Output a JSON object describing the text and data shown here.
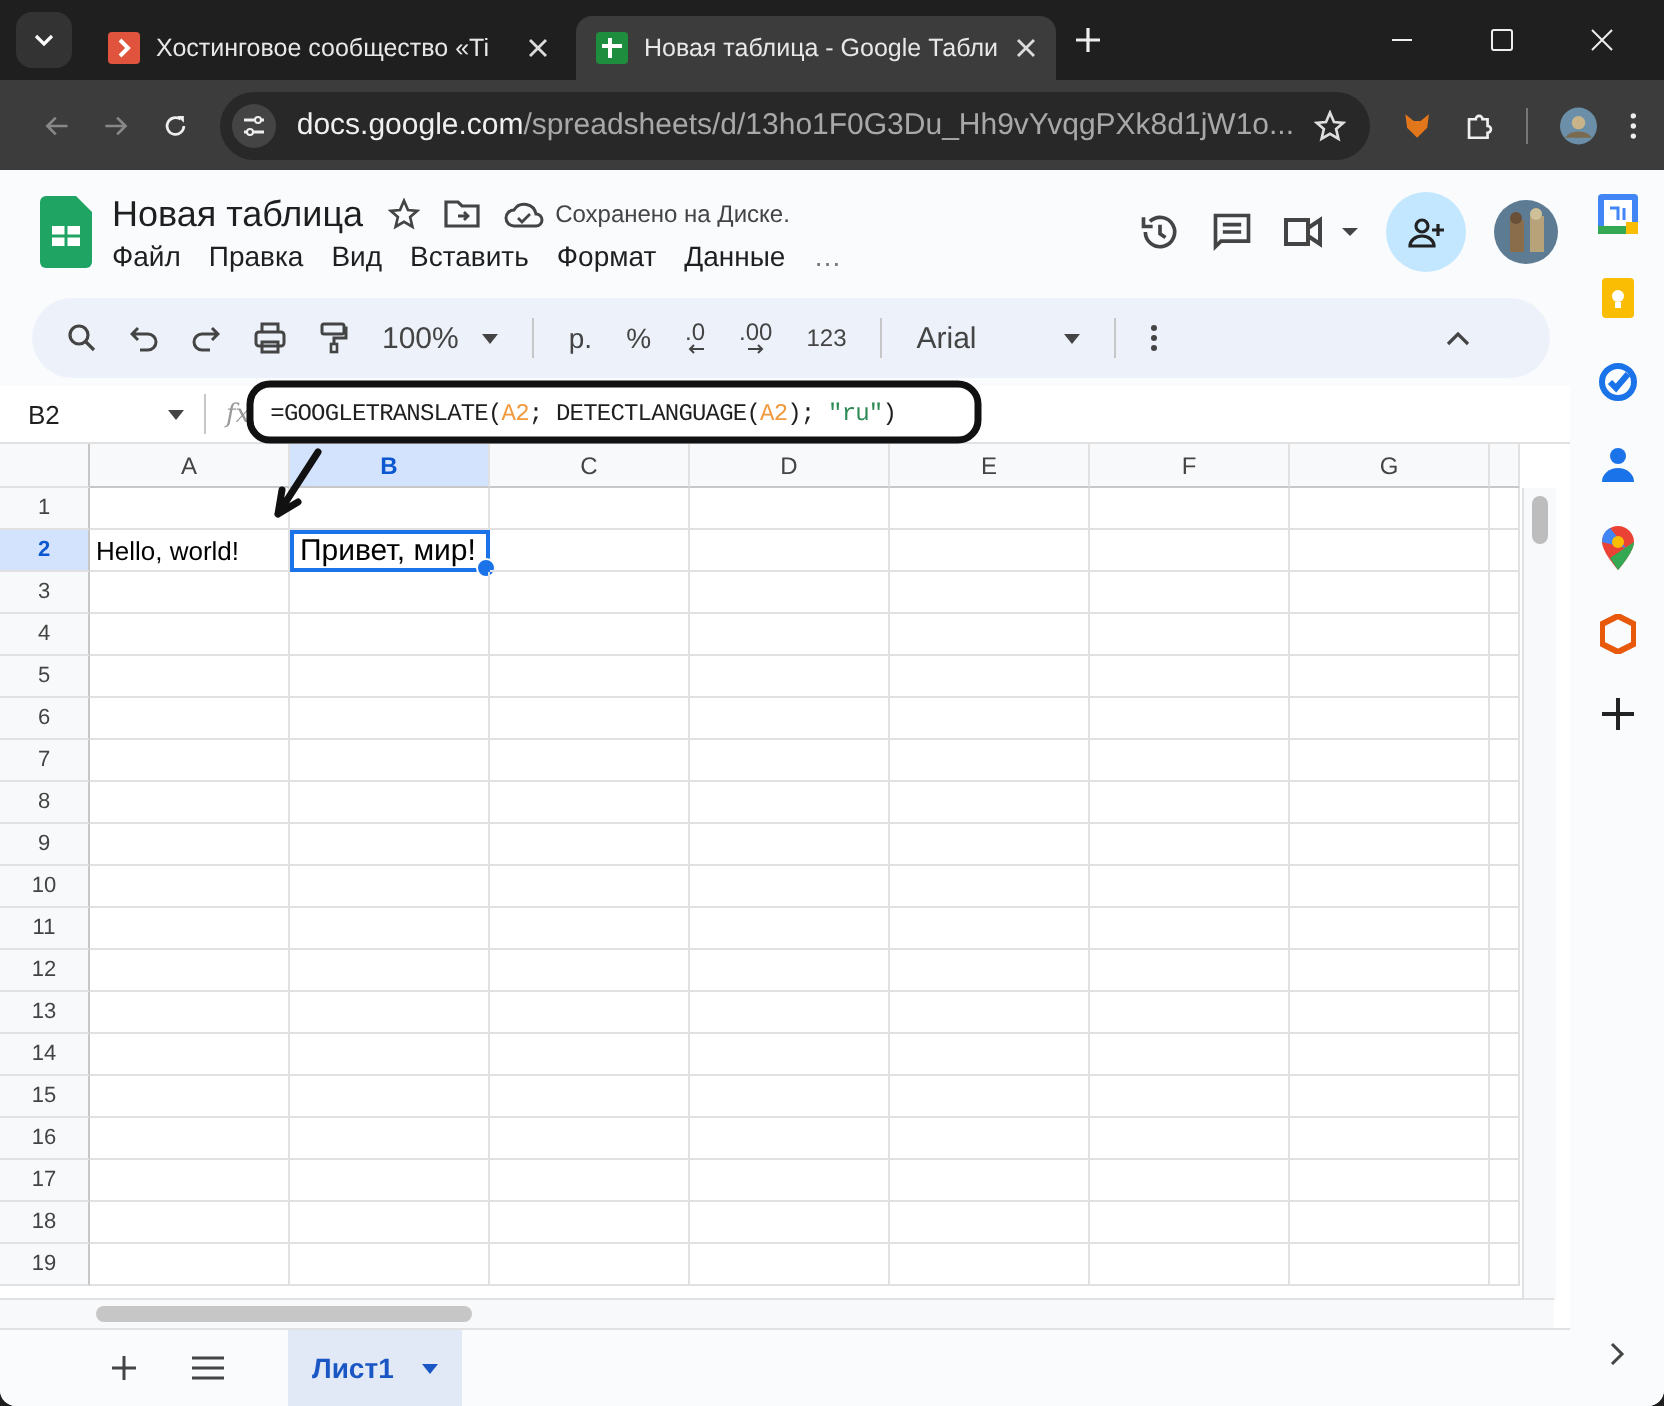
{
  "browser": {
    "tabs": [
      {
        "title": "Хостинговое сообщество «Ti",
        "kind": "site",
        "selected": false
      },
      {
        "title": "Новая таблица - Google Табли",
        "kind": "sheets",
        "selected": true
      }
    ],
    "url": {
      "host": "docs.google.com",
      "path": "/spreadsheets/d/13ho1F0G3Du_Hh9vYvqgPXk8d1jW1o..."
    }
  },
  "doc": {
    "title": "Новая таблица",
    "save_status": "Сохранено на Диске.",
    "menu": [
      "Файл",
      "Правка",
      "Вид",
      "Вставить",
      "Формат",
      "Данные"
    ],
    "menu_more": "…"
  },
  "toolbar": {
    "zoom": "100%",
    "currency": "р.",
    "percent": "%",
    "decrease_decimals": ".0",
    "increase_decimals": ".00",
    "number_format": "123",
    "font": "Arial"
  },
  "name_box": "B2",
  "function_symbol": "fx",
  "formula": [
    {
      "text": "=GOOGLETRANSLATE(",
      "kind": "plain"
    },
    {
      "text": "A2",
      "kind": "ref"
    },
    {
      "text": "; DETECTLANGUAGE(",
      "kind": "plain"
    },
    {
      "text": "A2",
      "kind": "ref"
    },
    {
      "text": "); ",
      "kind": "plain"
    },
    {
      "text": "\"ru\"",
      "kind": "string"
    },
    {
      "text": ")",
      "kind": "plain"
    }
  ],
  "columns": [
    {
      "label": "A",
      "selected": false
    },
    {
      "label": "B",
      "selected": true
    },
    {
      "label": "C",
      "selected": false
    },
    {
      "label": "D",
      "selected": false
    },
    {
      "label": "E",
      "selected": false
    },
    {
      "label": "F",
      "selected": false
    },
    {
      "label": "G",
      "selected": false
    }
  ],
  "rows": [
    {
      "number": "1",
      "selected": false,
      "cells": []
    },
    {
      "number": "2",
      "selected": true,
      "cells": [
        {
          "text": "Hello, world!",
          "selected": false
        },
        {
          "text": "Привет, мир!",
          "selected": true
        }
      ]
    },
    {
      "number": "3",
      "selected": false,
      "cells": []
    },
    {
      "number": "4",
      "selected": false,
      "cells": []
    },
    {
      "number": "5",
      "selected": false,
      "cells": []
    },
    {
      "number": "6",
      "selected": false,
      "cells": []
    },
    {
      "number": "7",
      "selected": false,
      "cells": []
    },
    {
      "number": "8",
      "selected": false,
      "cells": []
    },
    {
      "number": "9",
      "selected": false,
      "cells": []
    },
    {
      "number": "10",
      "selected": false,
      "cells": []
    },
    {
      "number": "11",
      "selected": false,
      "cells": []
    },
    {
      "number": "12",
      "selected": false,
      "cells": []
    },
    {
      "number": "13",
      "selected": false,
      "cells": []
    },
    {
      "number": "14",
      "selected": false,
      "cells": []
    },
    {
      "number": "15",
      "selected": false,
      "cells": []
    },
    {
      "number": "16",
      "selected": false,
      "cells": []
    },
    {
      "number": "17",
      "selected": false,
      "cells": []
    },
    {
      "number": "18",
      "selected": false,
      "cells": []
    },
    {
      "number": "19",
      "selected": false,
      "cells": []
    }
  ],
  "sheets": [
    {
      "name": "Лист1",
      "selected": true
    }
  ]
}
